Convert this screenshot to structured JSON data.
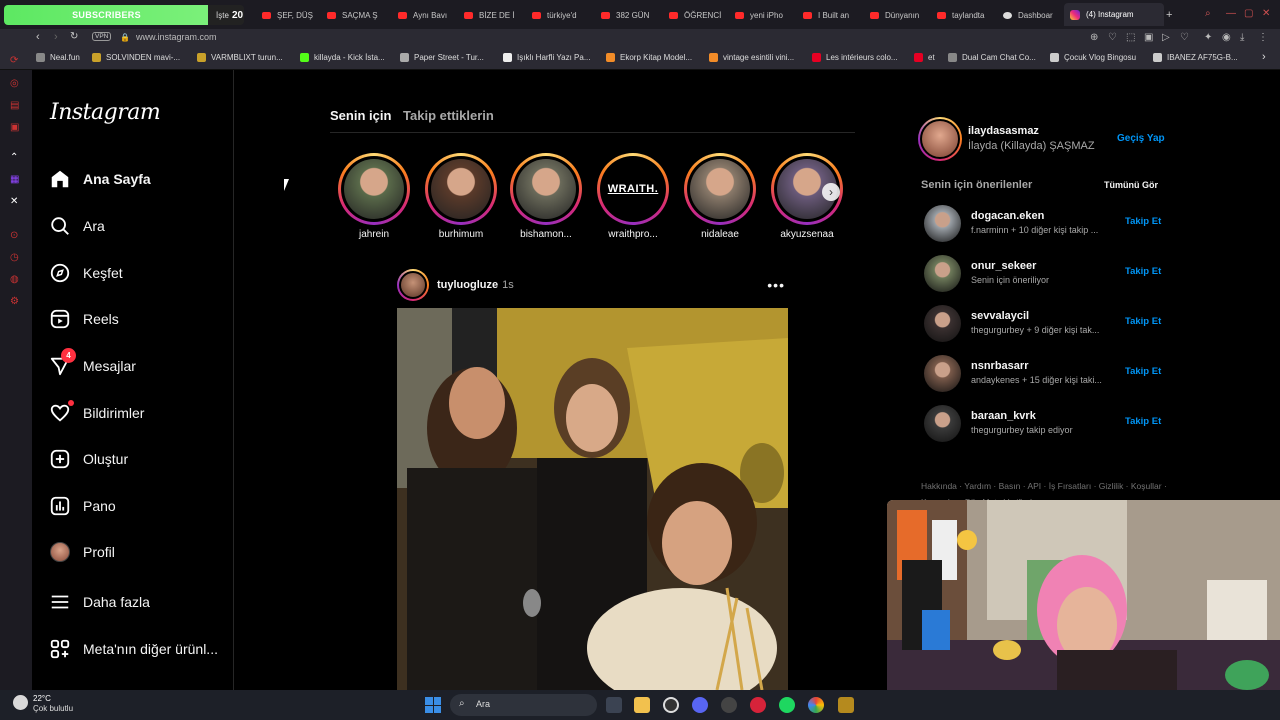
{
  "browser": {
    "subscriber_banner": {
      "label": "SUBSCRIBERS",
      "istek": "İşte",
      "count": "20"
    },
    "tabs": [
      {
        "label": "ŞEF, DÜŞ"
      },
      {
        "label": "SAÇMA Ş"
      },
      {
        "label": "Aynı Bavı"
      },
      {
        "label": "BİZE DE İ"
      },
      {
        "label": "türkiye'd"
      },
      {
        "label": "382 GÜN"
      },
      {
        "label": "ÖĞRENCİ"
      },
      {
        "label": "yeni iPho"
      },
      {
        "label": "I Built an"
      },
      {
        "label": "Dünyanın"
      },
      {
        "label": "taylandta"
      },
      {
        "label": "Dashboar"
      }
    ],
    "active_tab": {
      "label": "(4) Instagram",
      "close": "×"
    },
    "new_tab": "+",
    "url": "www.instagram.com",
    "vpn": "VPN",
    "bookmarks": [
      {
        "label": "Neal.fun",
        "color": "#888888"
      },
      {
        "label": "SOLVINDEN mavi-...",
        "color": "#c9a12a"
      },
      {
        "label": "VARMBLIXT turun...",
        "color": "#c9a12a"
      },
      {
        "label": "killayda - Kick İsta...",
        "color": "#53fc18"
      },
      {
        "label": "Paper Street - Tur...",
        "color": "#aaaaaa"
      },
      {
        "label": "Işıklı Harfli Yazı Pa...",
        "color": "#eeeeee"
      },
      {
        "label": "Ekorp Kitap Model...",
        "color": "#f28c28"
      },
      {
        "label": "vintage esintili vini...",
        "color": "#f28c28"
      },
      {
        "label": "Les intérieurs colo...",
        "color": "#e60023"
      },
      {
        "label": "et",
        "color": "#e60023"
      },
      {
        "label": "Dual Cam Chat Co...",
        "color": "#888888"
      },
      {
        "label": "Çocuk Vlog Bingosu",
        "color": "#cccccc"
      },
      {
        "label": "IBANEZ AF75G-B...",
        "color": "#cccccc"
      }
    ]
  },
  "instagram": {
    "logo": "Instagram",
    "nav": [
      {
        "label": "Ana Sayfa",
        "icon": "home-icon",
        "active": true
      },
      {
        "label": "Ara",
        "icon": "search-icon"
      },
      {
        "label": "Keşfet",
        "icon": "compass-icon"
      },
      {
        "label": "Reels",
        "icon": "reels-icon"
      },
      {
        "label": "Mesajlar",
        "icon": "messenger-icon",
        "badge": "4"
      },
      {
        "label": "Bildirimler",
        "icon": "heart-icon"
      },
      {
        "label": "Oluştur",
        "icon": "create-icon"
      },
      {
        "label": "Pano",
        "icon": "dashboard-icon"
      },
      {
        "label": "Profil",
        "icon": "avatar"
      },
      {
        "label": "Daha fazla",
        "icon": "menu-icon"
      },
      {
        "label": "Meta'nın diğer ürünl...",
        "icon": "apps-icon"
      }
    ],
    "feed_tabs": [
      "Senin için",
      "Takip ettiklerin"
    ],
    "stories": [
      {
        "name": "jahrein",
        "color": "#5a6a4a"
      },
      {
        "name": "burhimum",
        "color": "#5a3a2a"
      },
      {
        "name": "bishamon...",
        "color": "#6a6a5a"
      },
      {
        "name": "wraithpro...",
        "text": "WRAITH."
      },
      {
        "name": "nidaleae",
        "color": "#8a7a6a"
      },
      {
        "name": "akyuzsenaa",
        "color": "#6a5a7a"
      }
    ],
    "post": {
      "user": "tuyluogluze",
      "time": "1s",
      "more": "•••"
    },
    "me": {
      "username": "ilaydasasmaz",
      "fullname": "İlayda (Killayda) ŞAŞMAZ",
      "switch": "Geçiş Yap"
    },
    "suggestions_title": "Senin için önerilenler",
    "see_all": "Tümünü Gör",
    "suggestions": [
      {
        "user": "dogacan.eken",
        "sub": "f.narminn + 10 diğer kişi takip ...",
        "action": "Takip Et",
        "color": "#9aa0a6"
      },
      {
        "user": "onur_sekeer",
        "sub": "Senin için öneriliyor",
        "action": "Takip Et",
        "color": "#6e7a5a"
      },
      {
        "user": "sevvalaycil",
        "sub": "thegurgurbey + 9 diğer kişi tak...",
        "action": "Takip Et",
        "color": "#3a3030"
      },
      {
        "user": "nsnrbasarr",
        "sub": "andaykenes + 15 diğer kişi taki...",
        "action": "Takip Et",
        "color": "#7a5a4a"
      },
      {
        "user": "baraan_kvrk",
        "sub": "thegurgurbey takip ediyor",
        "action": "Takip Et",
        "color": "#3a3a3a"
      }
    ],
    "footer": "Hakkında · Yardım · Basın · API · İş Fırsatları · Gizlilik · Koşullar · Konumlar · Dil · Meta Verified"
  },
  "taskbar": {
    "temp": "22°C",
    "weather": "Çok bulutlu",
    "search": "Ara"
  }
}
